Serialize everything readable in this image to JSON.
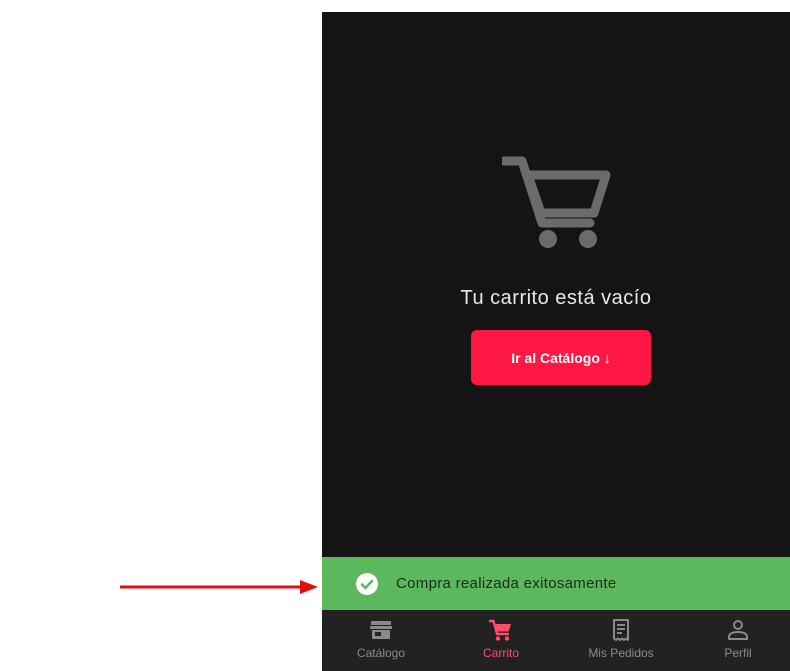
{
  "empty_cart": {
    "title": "Tu carrito está vacío",
    "button_label": "Ir al Catálogo ↓"
  },
  "toast": {
    "message": "Compra realizada exitosamente",
    "icon": "check-circle-icon",
    "color": "#5cb85c"
  },
  "bottom_nav": {
    "items": [
      {
        "label": "Catálogo",
        "icon": "store-icon"
      },
      {
        "label": "Carrito",
        "icon": "cart-icon",
        "active": true
      },
      {
        "label": "Mis Pedidos",
        "icon": "receipt-icon"
      },
      {
        "label": "Perfil",
        "icon": "person-icon"
      }
    ]
  },
  "colors": {
    "accent": "#ff1744",
    "active_nav": "#ff4d6a",
    "background": "#141414",
    "annotation_arrow": "#e01010"
  }
}
